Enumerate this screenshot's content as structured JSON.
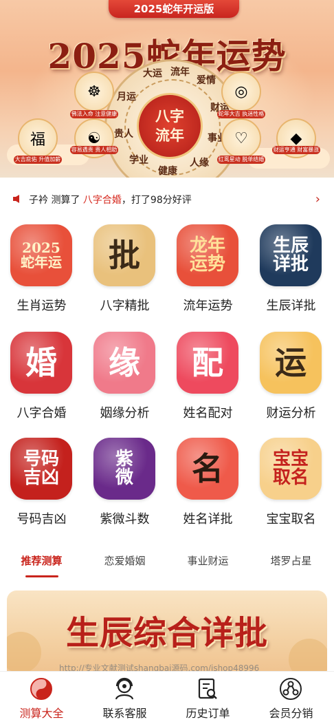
{
  "banner": {
    "badge": "2025蛇年开运版",
    "title": "2025蛇年运势",
    "center": "八字流年",
    "wheel_chars": [
      "大运",
      "流年",
      "爱情",
      "财运",
      "事业",
      "人缘",
      "健康",
      "学业",
      "贵人",
      "月运"
    ],
    "bubbles": [
      {
        "icon": "buddha-icon",
        "text": "佛法入命 注意健康"
      },
      {
        "icon": "jade-icon",
        "text": "蛇年大吉 执迷性格"
      },
      {
        "icon": "fortune-seal-icon",
        "text": "大吉庇佑 升值加薪"
      },
      {
        "icon": "sage-icon",
        "text": "容易遇贵 贵人相助"
      },
      {
        "icon": "ring-icon",
        "text": "红鸾星动 脱单结婚"
      },
      {
        "icon": "treasure-icon",
        "text": "财运亨通 财富暴涨"
      }
    ]
  },
  "notice": {
    "user": "子衿",
    "verb": "测算了",
    "item": "八字合婚",
    "tail": "，打了98分好评"
  },
  "grid": [
    {
      "label": "生肖运势",
      "glyph": "2025\n蛇年运",
      "bg": "#e8503a",
      "fg": "#fff3c8",
      "icon": "snake-zodiac-icon"
    },
    {
      "label": "八字精批",
      "glyph": "批",
      "bg": "#e9c17c",
      "fg": "#3b2a18",
      "icon": "scroll-pi-icon"
    },
    {
      "label": "流年运势",
      "glyph": "龙年\n运势",
      "bg": "#e8503a",
      "fg": "#ffe29a",
      "icon": "year-fortune-icon"
    },
    {
      "label": "生辰详批",
      "glyph": "生辰\n详批",
      "bg": "#1f3a5c",
      "fg": "#ffffff",
      "icon": "taiji-icon"
    },
    {
      "label": "八字合婚",
      "glyph": "婚",
      "bg": "#d8353a",
      "fg": "#ffffff",
      "icon": "wedding-dress-icon"
    },
    {
      "label": "姻缘分析",
      "glyph": "缘",
      "bg": "#f07a8a",
      "fg": "#ffffff",
      "icon": "fate-yuan-icon"
    },
    {
      "label": "姓名配对",
      "glyph": "配",
      "bg": "#ee4a5e",
      "fg": "#ffffff",
      "icon": "name-match-icon"
    },
    {
      "label": "财运分析",
      "glyph": "运",
      "bg": "#f6c25d",
      "fg": "#3b2a18",
      "icon": "coin-fortune-icon"
    },
    {
      "label": "号码吉凶",
      "glyph": "号码\n吉凶",
      "bg": "#c4211d",
      "fg": "#ffffff",
      "icon": "number-luck-icon"
    },
    {
      "label": "紫微斗数",
      "glyph": "紫\n微",
      "bg": "#6a2a8a",
      "fg": "#ffffff",
      "icon": "ziwei-icon"
    },
    {
      "label": "姓名详批",
      "glyph": "名",
      "bg": "#ef5a4a",
      "fg": "#2a1a10",
      "icon": "name-scroll-icon"
    },
    {
      "label": "宝宝取名",
      "glyph": "宝宝\n取名",
      "bg": "#f7d08b",
      "fg": "#c4211d",
      "icon": "baby-naming-icon"
    }
  ],
  "tabs": [
    "推荐测算",
    "恋爱婚姻",
    "事业财运",
    "塔罗占星"
  ],
  "promo": {
    "title": "生辰综合详批",
    "watermark": "http://专业文献测试shangbai源码.com/ishop48996"
  },
  "nav": [
    {
      "label": "测算大全",
      "icon": "taiji-nav-icon"
    },
    {
      "label": "联系客服",
      "icon": "service-person-icon"
    },
    {
      "label": "历史订单",
      "icon": "order-search-icon"
    },
    {
      "label": "会员分销",
      "icon": "share-network-icon"
    }
  ],
  "colors": {
    "accent": "#c9241c",
    "text": "#222222"
  }
}
